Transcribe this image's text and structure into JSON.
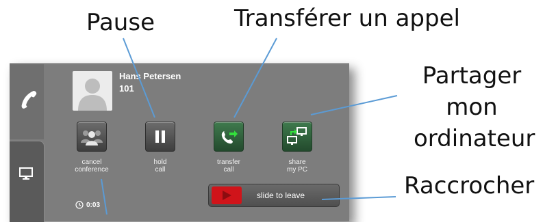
{
  "callouts": {
    "pause": "Pause",
    "transfer": "Transférer un appel",
    "share_lines": [
      "Partager",
      "mon",
      "ordinateur"
    ],
    "hangup": "Raccrocher"
  },
  "contact": {
    "name": "Hans Petersen",
    "number": "101"
  },
  "actions": [
    {
      "icon": "conference-icon",
      "line1": "cancel",
      "line2": "conference"
    },
    {
      "icon": "pause-icon",
      "line1": "hold",
      "line2": "call"
    },
    {
      "icon": "transfer-call-icon",
      "line1": "transfer",
      "line2": "call"
    },
    {
      "icon": "share-screen-icon",
      "line1": "share",
      "line2": "my PC"
    }
  ],
  "slider": {
    "label": "slide to leave",
    "icon": "play-arrow-icon"
  },
  "timer": {
    "value": "0:03",
    "icon": "clock-icon"
  },
  "sidebar": {
    "phone_icon": "phone-handset-icon",
    "screen_icon": "monitor-icon"
  }
}
